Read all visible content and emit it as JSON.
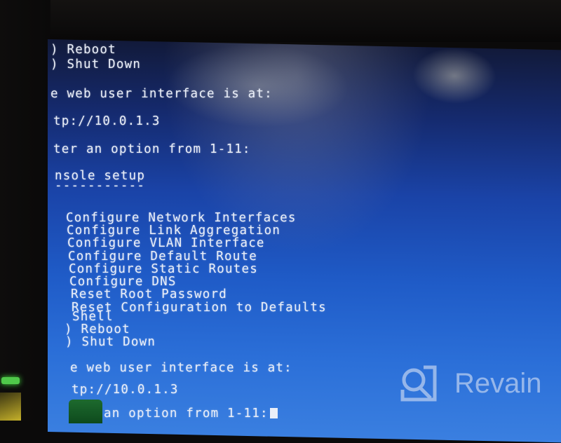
{
  "photo": {
    "subject": "monitor displaying console setup menu"
  },
  "console": {
    "top_menu_tail": [
      ") Reboot",
      ") Shut Down"
    ],
    "web_ui_label": "e web user interface is at:",
    "web_ui_url": "tp://10.0.1.3",
    "prompt_label": "ter an option from 1-11:",
    "section_title": "nsole setup",
    "section_underline": "-----------",
    "menu_items": [
      "Configure Network Interfaces",
      "Configure Link Aggregation",
      "Configure VLAN Interface",
      "Configure Default Route",
      "Configure Static Routes",
      "Configure DNS",
      "Reset Root Password",
      "Reset Configuration to Defaults",
      "Shell",
      ") Reboot",
      ") Shut Down"
    ],
    "web_ui_label_bottom": "e web user interface is at:",
    "web_ui_url_bottom": "tp://10.0.1.3",
    "prompt_bottom": "an option from 1-11:"
  },
  "watermark": {
    "text": "Revain",
    "icon": "revain-logo-icon"
  },
  "colors": {
    "screen_blue": "#1f5bc7",
    "text": "#e9eef8",
    "bezel": "#0b0a0a"
  }
}
